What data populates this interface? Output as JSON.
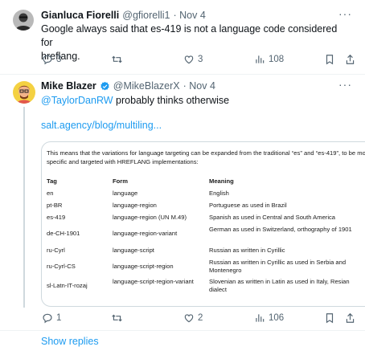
{
  "tweet1": {
    "name": "Gianluca Fiorelli",
    "handle": "@gfiorelli1",
    "date": "· Nov 4",
    "text_line1": "Google always said that es-419 is not a language code considered for",
    "text_line2": "hreflang.",
    "replies": "3",
    "retweets": "",
    "likes": "3",
    "views": "108"
  },
  "tweet2": {
    "name": "Mike Blazer",
    "handle": "@MikeBlazerX",
    "date": "· Nov 4",
    "mention": "@TaylorDanRW",
    "text": " probably thinks otherwise",
    "link": "salt.agency/blog/multiling...",
    "replies": "1",
    "retweets": "",
    "likes": "2",
    "views": "106"
  },
  "card": {
    "intro": "This means that the variations for language targeting can be expanded from the traditional “es” and “es-419”, to be more specific and targeted with HREFLANG implementations:",
    "headers": [
      "Tag",
      "Form",
      "Meaning"
    ],
    "rows": [
      [
        "en",
        "language",
        "English"
      ],
      [
        "pt-BR",
        "language-region",
        "Portuguese as used in Brazil"
      ],
      [
        "es-419",
        "language-region (UN M.49)",
        "Spanish as used in Central and South America"
      ],
      [
        "de-CH-1901",
        "language-region-variant",
        "German as used in Switzerland, orthography of 1901"
      ],
      [
        "ru-Cyrl",
        "language-script",
        "Russian as written in Cyrillic"
      ],
      [
        "ru-Cyrl-CS",
        "language-script-region",
        "Russian as written in Cyrillic as used in Serbia and Montenegro"
      ],
      [
        "sl-Latn-IT-rozaj",
        "language-script-region-variant",
        "Slovenian as written in Latin as used in Italy, Resian dialect"
      ]
    ]
  },
  "show_replies": "Show replies",
  "colors": {
    "link": "#1d9bf0",
    "muted": "#536471",
    "verified": "#1d9bf0"
  },
  "icons": [
    "more-icon",
    "reply-icon",
    "retweet-icon",
    "like-icon",
    "views-icon",
    "bookmark-icon",
    "share-icon",
    "verified-badge-icon"
  ]
}
